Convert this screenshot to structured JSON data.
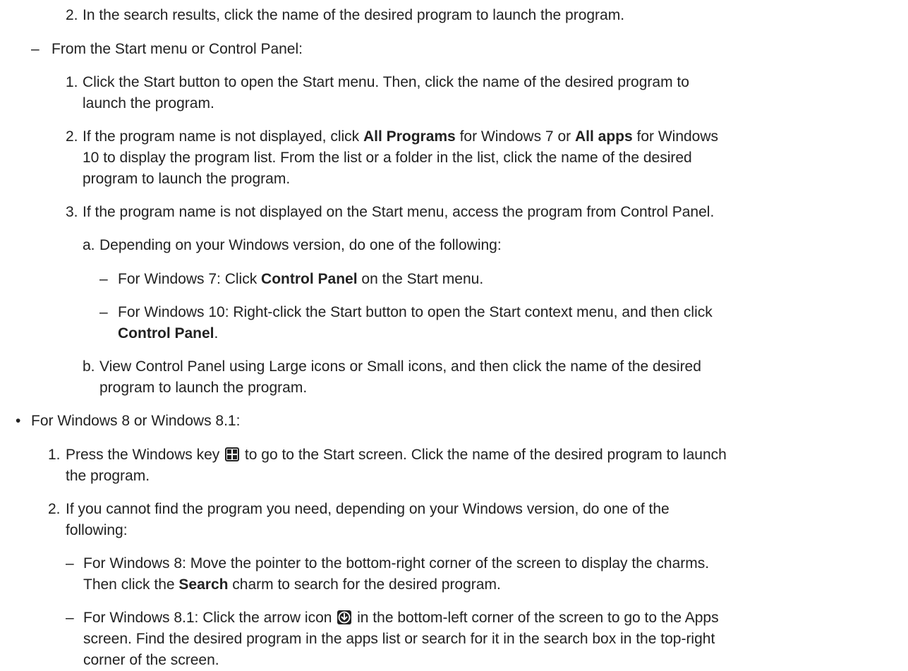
{
  "markers": {
    "n1": "1.",
    "n2": "2.",
    "n3": "3.",
    "la": "a.",
    "lb": "b.",
    "dash": "–",
    "bullet": "•"
  },
  "top_step2": {
    "text": "In the search results, click the name of the desired program to launch the program."
  },
  "from_start": {
    "heading": "From the Start menu or Control Panel:",
    "step1": {
      "line1": "Click the Start button to open the Start menu. Then, click the name of the desired program to",
      "line2": "launch the program."
    },
    "step2": {
      "l1_a": "If the program name is not displayed, click ",
      "l1_b1": "All Programs",
      "l1_c": " for Windows 7 or ",
      "l1_b2": "All apps",
      "l1_d": " for Windows",
      "line2": "10 to display the program list. From the list or a folder in the list, click the name of the desired",
      "line3": "program to launch the program."
    },
    "step3": {
      "text": "If the program name is not displayed on the Start menu, access the program from Control Panel.",
      "a_text": "Depending on your Windows version, do one of the following:",
      "a_win7_pre": "For Windows 7: Click ",
      "a_win7_bold": "Control Panel",
      "a_win7_post": " on the Start menu.",
      "a_win10_line1": "For Windows 10: Right-click the Start button to open the Start context menu, and then click",
      "a_win10_bold": "Control Panel",
      "a_win10_post": ".",
      "b_line1": "View Control Panel using Large icons or Small icons, and then click the name of the desired",
      "b_line2": "program to launch the program."
    }
  },
  "win8": {
    "heading": "For Windows 8 or Windows 8.1:",
    "step1": {
      "pre": "Press the Windows key ",
      "post": " to go to the Start screen. Click the name of the desired program to launch",
      "line2": "the program.",
      "icon": "windows-key-icon"
    },
    "step2": {
      "line1": "If you cannot find the program you need, depending on your Windows version, do one of the",
      "line2": "following:"
    },
    "win8_item": {
      "line1": "For Windows 8: Move the pointer to the bottom-right corner of the screen to display the charms.",
      "pre": "Then click the ",
      "bold": "Search",
      "post": " charm to search for the desired program."
    },
    "win81_item": {
      "pre": "For Windows 8.1: Click the arrow icon ",
      "post": " in the bottom-left corner of the screen to go to the Apps",
      "line2": "screen. Find the desired program in the apps list or search for it in the search box in the top-right",
      "line3": "corner of the screen.",
      "icon": "arrow-down-circle-icon"
    }
  }
}
